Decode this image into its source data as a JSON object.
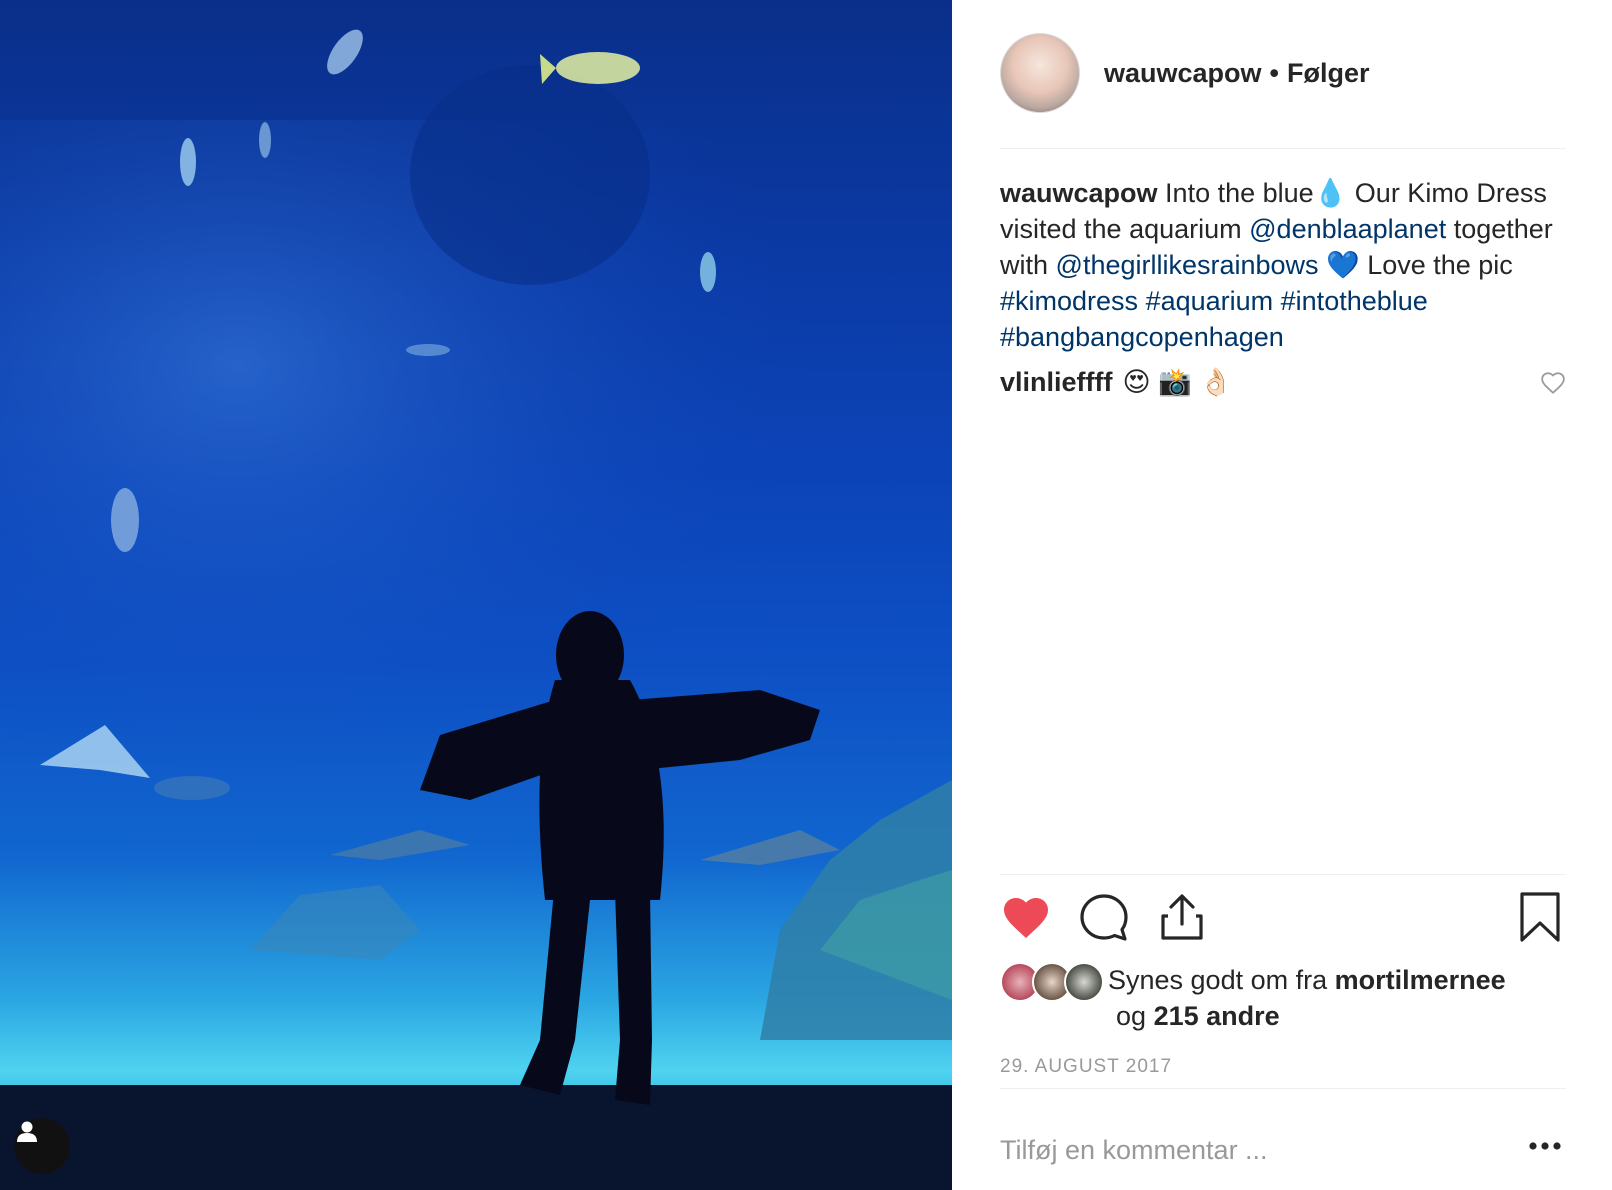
{
  "post": {
    "author": "wauwcapow",
    "separator": "•",
    "follow_label": "Følger",
    "caption": {
      "username": "wauwcapow",
      "part1": "Into the blue",
      "emoji_drop": "💧",
      "part2": " Our Kimo Dress visited the aquarium ",
      "mention1": "@denblaaplanet",
      "part3": " together with ",
      "mention2": "@thegirllikesrainbows",
      "emoji_heart": "💙",
      "part4": " Love the pic ",
      "tag1": "#kimodress",
      "tag2": "#aquarium",
      "tag3": "#intotheblue",
      "tag4": "#bangbangcopenhagen"
    },
    "comments": [
      {
        "username": "vlinlieffff",
        "text": "😍 📸 👌🏻"
      }
    ],
    "likes": {
      "prefix": "Synes godt om fra",
      "first_liker": "mortilmernee",
      "conjunction": "og",
      "others": "215 andre"
    },
    "date": "29. AUGUST 2017",
    "add_comment_placeholder": "Tilføj en kommentar ...",
    "liked": true
  },
  "colors": {
    "like_red": "#ed4956",
    "link_blue": "#003569",
    "muted_gray": "#999999",
    "text": "#262626"
  },
  "icons": {
    "like": "heart-filled-icon",
    "comment": "comment-bubble-icon",
    "share": "share-upload-icon",
    "save": "bookmark-icon",
    "comment_like": "heart-outline-icon",
    "more": "more-dots-icon",
    "user_tags": "user-silhouette-icon"
  }
}
